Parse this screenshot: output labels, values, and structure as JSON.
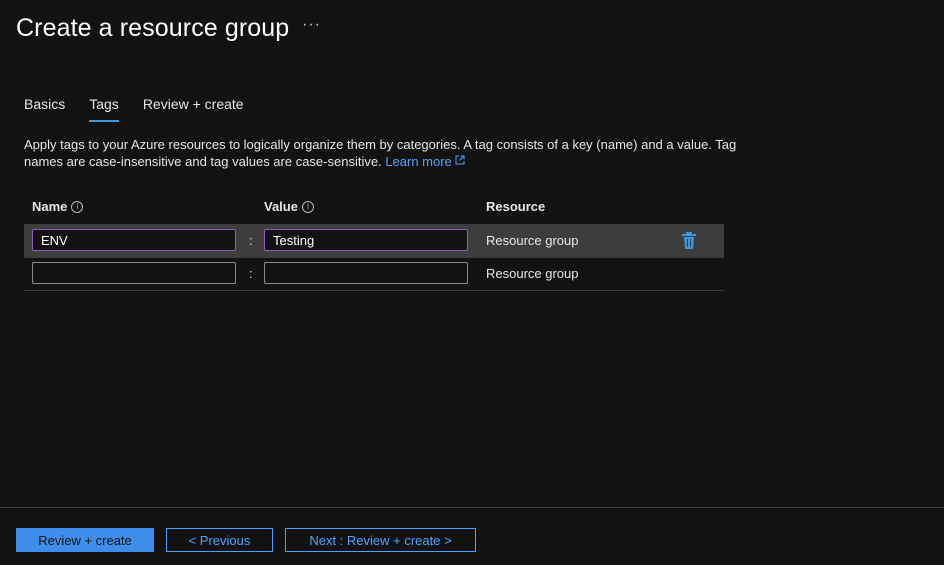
{
  "header": {
    "title": "Create a resource group",
    "more_label": "···"
  },
  "tabs": [
    {
      "label": "Basics",
      "active": false
    },
    {
      "label": "Tags",
      "active": true
    },
    {
      "label": "Review + create",
      "active": false
    }
  ],
  "description": {
    "text": "Apply tags to your Azure resources to logically organize them by categories. A tag consists of a key (name) and a value. Tag names are case-insensitive and tag values are case-sensitive.",
    "link_label": "Learn more"
  },
  "grid": {
    "columns": {
      "name": "Name",
      "value": "Value",
      "resource": "Resource"
    },
    "separator": ":",
    "rows": [
      {
        "name": "ENV",
        "value": "Testing",
        "resource": "Resource group"
      },
      {
        "name": "",
        "value": "",
        "resource": "Resource group"
      }
    ]
  },
  "footer": {
    "review_create": "Review + create",
    "previous": "< Previous",
    "next": "Next : Review + create >"
  },
  "colors": {
    "accent": "#3d8eea",
    "link": "#4da3ff",
    "tab_underline": "#3a96dd",
    "focus_border": "#8e5bbd",
    "delete_icon": "#3a96dd"
  },
  "icons": {
    "delete": "trash-icon",
    "info": "info-icon",
    "external": "external-link-icon"
  }
}
